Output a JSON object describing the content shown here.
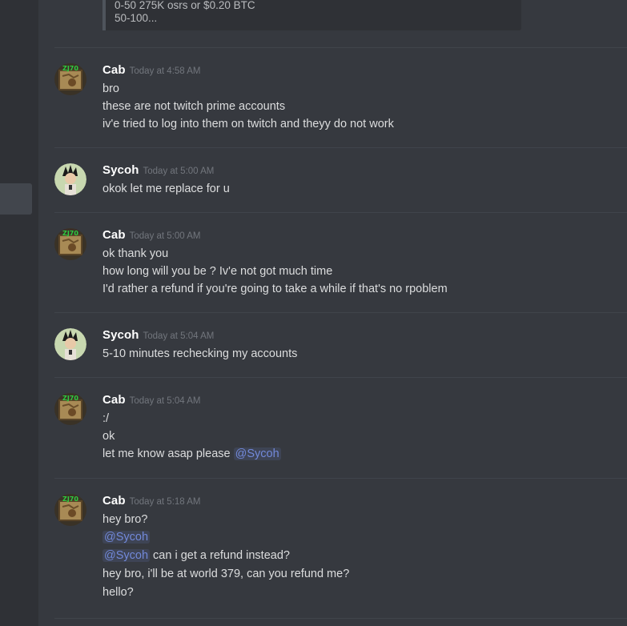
{
  "embed": {
    "lines": [
      "0-50 275K osrs or $0.20 BTC",
      "50-100..."
    ]
  },
  "messages": [
    {
      "user": "Cab",
      "time": "Today at 4:58 AM",
      "avatar": "treasure-map-avatar-icon",
      "lines": [
        "bro",
        "these are not twitch prime accounts",
        "iv'e tried to log into them on twitch and theyy do not work"
      ]
    },
    {
      "user": "Sycoh",
      "time": "Today at 5:00 AM",
      "avatar": "anime-character-avatar-icon",
      "lines": [
        "okok let me replace for u"
      ]
    },
    {
      "user": "Cab",
      "time": "Today at 5:00 AM",
      "avatar": "treasure-map-avatar-icon",
      "lines": [
        "ok thank you",
        "how long will you be ? Iv'e not got much time",
        "I'd rather a refund if you're going to take a while if that's no rpoblem"
      ]
    },
    {
      "user": "Sycoh",
      "time": "Today at 5:04 AM",
      "avatar": "anime-character-avatar-icon",
      "lines": [
        "5-10 minutes rechecking my accounts"
      ]
    },
    {
      "user": "Cab",
      "time": "Today at 5:04 AM",
      "avatar": "treasure-map-avatar-icon",
      "lines": [
        ":/",
        "ok",
        "let me know asap please "
      ],
      "mention": "@Sycoh"
    },
    {
      "user": "Cab",
      "time": "Today at 5:18 AM",
      "avatar": "treasure-map-avatar-icon",
      "lines": [
        "hey bro?",
        "",
        " can i get a refund instead?",
        "hey bro, i'll be at world 379, can you refund me?",
        "hello?"
      ],
      "mentions": [
        "@Sycoh",
        "@Sycoh"
      ]
    }
  ],
  "colors": {
    "background": "#36393f",
    "rail": "#2f3136",
    "mention": "#7289da",
    "timestamp": "#72767d",
    "text": "#dcddde"
  }
}
